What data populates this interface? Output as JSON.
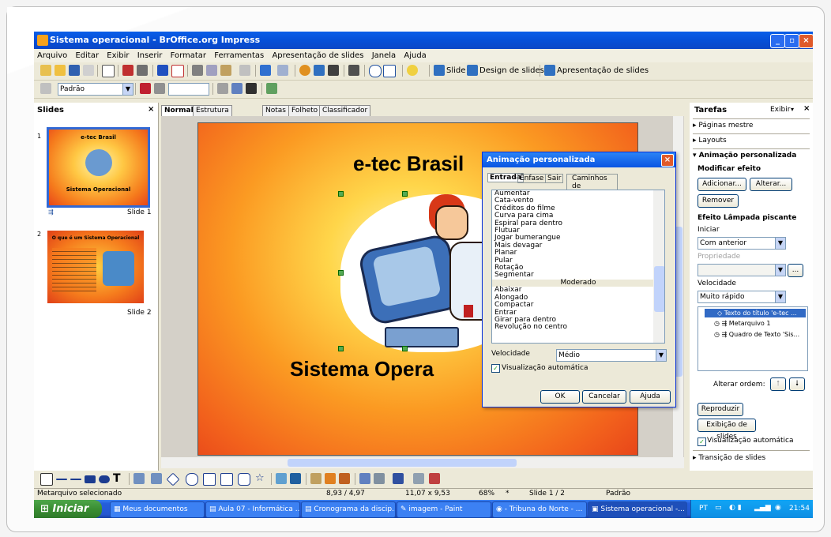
{
  "window": {
    "title": "Sistema operacional - BrOffice.org Impress",
    "min": "_",
    "max": "▫",
    "close": "×"
  },
  "menu": [
    "Arquivo",
    "Editar",
    "Exibir",
    "Inserir",
    "Formatar",
    "Ferramentas",
    "Apresentação de slides",
    "Janela",
    "Ajuda"
  ],
  "toolbar": {
    "slide_label": "Slide",
    "design_label": "Design de slides",
    "presentation_label": "Apresentação de slides"
  },
  "formatbar": {
    "style_value": "Padrão"
  },
  "slides_panel": {
    "title": "Slides",
    "close": "×",
    "items": [
      {
        "number": "1",
        "title": "e-tec Brasil",
        "subtitle": "Sistema Operacional",
        "caption": "Slide 1"
      },
      {
        "number": "2",
        "title": "O que é um Sistema Operacional",
        "caption": "Slide 2"
      }
    ]
  },
  "tabs": [
    "Normal",
    "Estrutura de tópicos",
    "Notas",
    "Folheto",
    "Classificador de slides"
  ],
  "slide": {
    "title": "e-tec Brasil",
    "subtitle": "Sistema Opera"
  },
  "dialog": {
    "title": "Animação personalizada",
    "tabs": [
      "Entrada",
      "Ênfase",
      "Sair",
      "Caminhos de movimento"
    ],
    "effects": [
      "Aumentar",
      "Cata-vento",
      "Créditos do filme",
      "Curva para cima",
      "Espiral para dentro",
      "Flutuar",
      "Jogar bumerangue",
      "Mais devagar",
      "Planar",
      "Pular",
      "Rotação",
      "Segmentar"
    ],
    "group_header": "Moderado",
    "effects2": [
      "Abaixar",
      "Alongado",
      "Compactar",
      "Entrar",
      "Girar para dentro",
      "Revolução no centro"
    ],
    "speed_label": "Velocidade",
    "speed_value": "Médio",
    "auto_preview": "Visualização automática",
    "ok": "OK",
    "cancel": "Cancelar",
    "help": "Ajuda"
  },
  "tasks": {
    "title": "Tarefas",
    "view": "Exibir",
    "close": "×",
    "master": "Páginas mestre",
    "layouts": "Layouts",
    "custom_anim": "Animação personalizada",
    "modify": "Modificar efeito",
    "add": "Adicionar...",
    "change": "Alterar...",
    "remove": "Remover",
    "effect_title": "Efeito Lâmpada piscante",
    "start_label": "Iniciar",
    "start_value": "Com anterior",
    "property_label": "Propriedade",
    "speed_label": "Velocidade",
    "speed_value": "Muito rápido",
    "list": [
      "Texto do título 'e-tec ...",
      "Metarquivo 1",
      "Quadro de Texto 'Sis..."
    ],
    "order_label": "Alterar ordem:",
    "play": "Reproduzir",
    "slideshow": "Exibição de slides",
    "auto_preview": "Visualização automática",
    "transition": "Transição de slides",
    "ellipsis": "..."
  },
  "status": {
    "left": "Metarquivo selecionado",
    "pos": "8,93 / 4,97",
    "size": "11,07 x 9,53",
    "zoom": "68%",
    "star": "*",
    "slide": "Slide 1 / 2",
    "layout": "Padrão"
  },
  "taskbar": {
    "start": "Iniciar",
    "items": [
      "Meus documentos",
      "Aula 07 - Informática ...",
      "Cronograma da discip...",
      "imagem - Paint",
      "- Tribuna do Norte - ...",
      "Sistema operacional -..."
    ],
    "lang": "PT",
    "clock": "21:54"
  }
}
